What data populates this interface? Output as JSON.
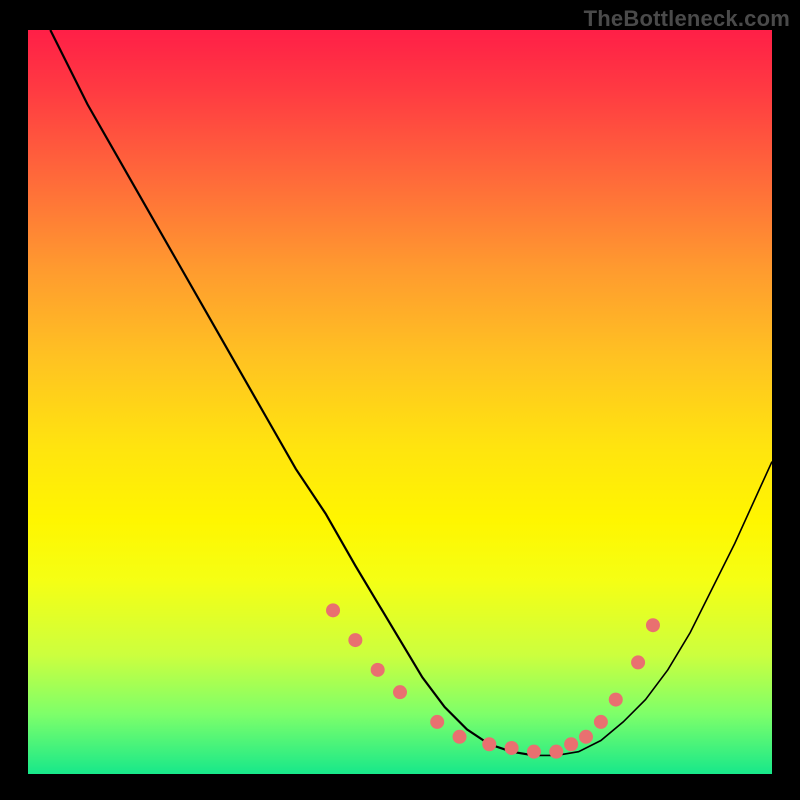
{
  "watermark": "TheBottleneck.com",
  "colors": {
    "point": "#e97070",
    "curve": "#000000",
    "frame": "#000000"
  },
  "chart_data": {
    "type": "line",
    "title": "",
    "xlabel": "",
    "ylabel": "",
    "xlim": [
      0,
      100
    ],
    "ylim": [
      0,
      100
    ],
    "grid": false,
    "legend": false,
    "series": [
      {
        "name": "bottleneck-curve",
        "x": [
          3,
          5,
          8,
          12,
          16,
          20,
          24,
          28,
          32,
          36,
          40,
          44,
          47,
          50,
          53,
          56,
          59,
          62,
          65,
          68,
          71,
          74,
          77,
          80,
          83,
          86,
          89,
          92,
          95,
          100
        ],
        "y": [
          100,
          96,
          90,
          83,
          76,
          69,
          62,
          55,
          48,
          41,
          35,
          28,
          23,
          18,
          13,
          9,
          6,
          4,
          3,
          2.5,
          2.5,
          3,
          4.5,
          7,
          10,
          14,
          19,
          25,
          31,
          42
        ]
      }
    ],
    "points": {
      "name": "highlight-dots",
      "x": [
        41,
        44,
        47,
        50,
        55,
        58,
        62,
        65,
        68,
        71,
        73,
        75,
        77,
        79,
        82,
        84
      ],
      "y": [
        22,
        18,
        14,
        11,
        7,
        5,
        4,
        3.5,
        3,
        3,
        4,
        5,
        7,
        10,
        15,
        20
      ]
    }
  }
}
